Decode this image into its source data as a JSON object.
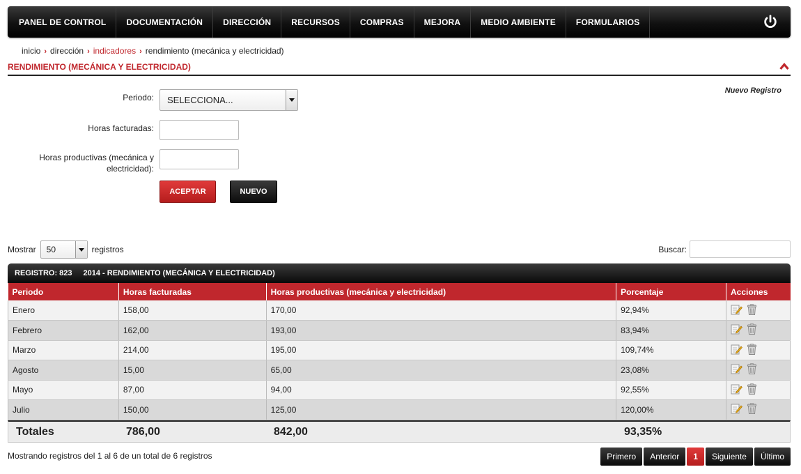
{
  "nav": {
    "items": [
      "PANEL DE CONTROL",
      "DOCUMENTACIÓN",
      "DIRECCIÓN",
      "RECURSOS",
      "COMPRAS",
      "MEJORA",
      "MEDIO AMBIENTE",
      "FORMULARIOS"
    ],
    "power_icon": "power-icon"
  },
  "breadcrumb": {
    "items": [
      "inicio",
      "dirección",
      "indicadores",
      "rendimiento (mecánica y electricidad)"
    ]
  },
  "section": {
    "title": "RENDIMIENTO (MECÁNICA Y ELECTRICIDAD)",
    "new_record": "Nuevo Registro"
  },
  "form": {
    "periodo_label": "Periodo:",
    "periodo_value": "SELECCIONA...",
    "horas_facturadas_label": "Horas facturadas:",
    "horas_productivas_label_1": "Horas productivas (mecánica y",
    "horas_productivas_label_2": "electricidad):",
    "accept_label": "ACEPTAR",
    "new_label": "NUEVO"
  },
  "table_controls": {
    "show_label": "Mostrar",
    "show_value": "50",
    "records_label": "registros",
    "search_label": "Buscar:"
  },
  "table_bar": {
    "registro": "REGISTRO: 823",
    "title": "2014 - RENDIMIENTO (MECÁNICA Y ELECTRICIDAD)"
  },
  "table": {
    "headers": [
      "Periodo",
      "Horas facturadas",
      "Horas productivas (mecánica y electricidad)",
      "Porcentaje",
      "Acciones"
    ],
    "rows": [
      [
        "Enero",
        "158,00",
        "170,00",
        "92,94%"
      ],
      [
        "Febrero",
        "162,00",
        "193,00",
        "83,94%"
      ],
      [
        "Marzo",
        "214,00",
        "195,00",
        "109,74%"
      ],
      [
        "Agosto",
        "15,00",
        "65,00",
        "23,08%"
      ],
      [
        "Mayo",
        "87,00",
        "94,00",
        "92,55%"
      ],
      [
        "Julio",
        "150,00",
        "125,00",
        "120,00%"
      ]
    ],
    "row_icons": [
      "edit-icon",
      "delete-icon"
    ]
  },
  "totals": {
    "label": "Totales",
    "horas_facturadas": "786,00",
    "horas_productivas": "842,00",
    "porcentaje": "93,35%"
  },
  "footer": {
    "info": "Mostrando registros del 1 al 6 de un total de 6 registros",
    "pager": {
      "first": "Primero",
      "prev": "Anterior",
      "current": "1",
      "next": "Siguiente",
      "last": "Último"
    }
  },
  "colors": {
    "accent": "#c0272d",
    "dark": "#111111"
  }
}
